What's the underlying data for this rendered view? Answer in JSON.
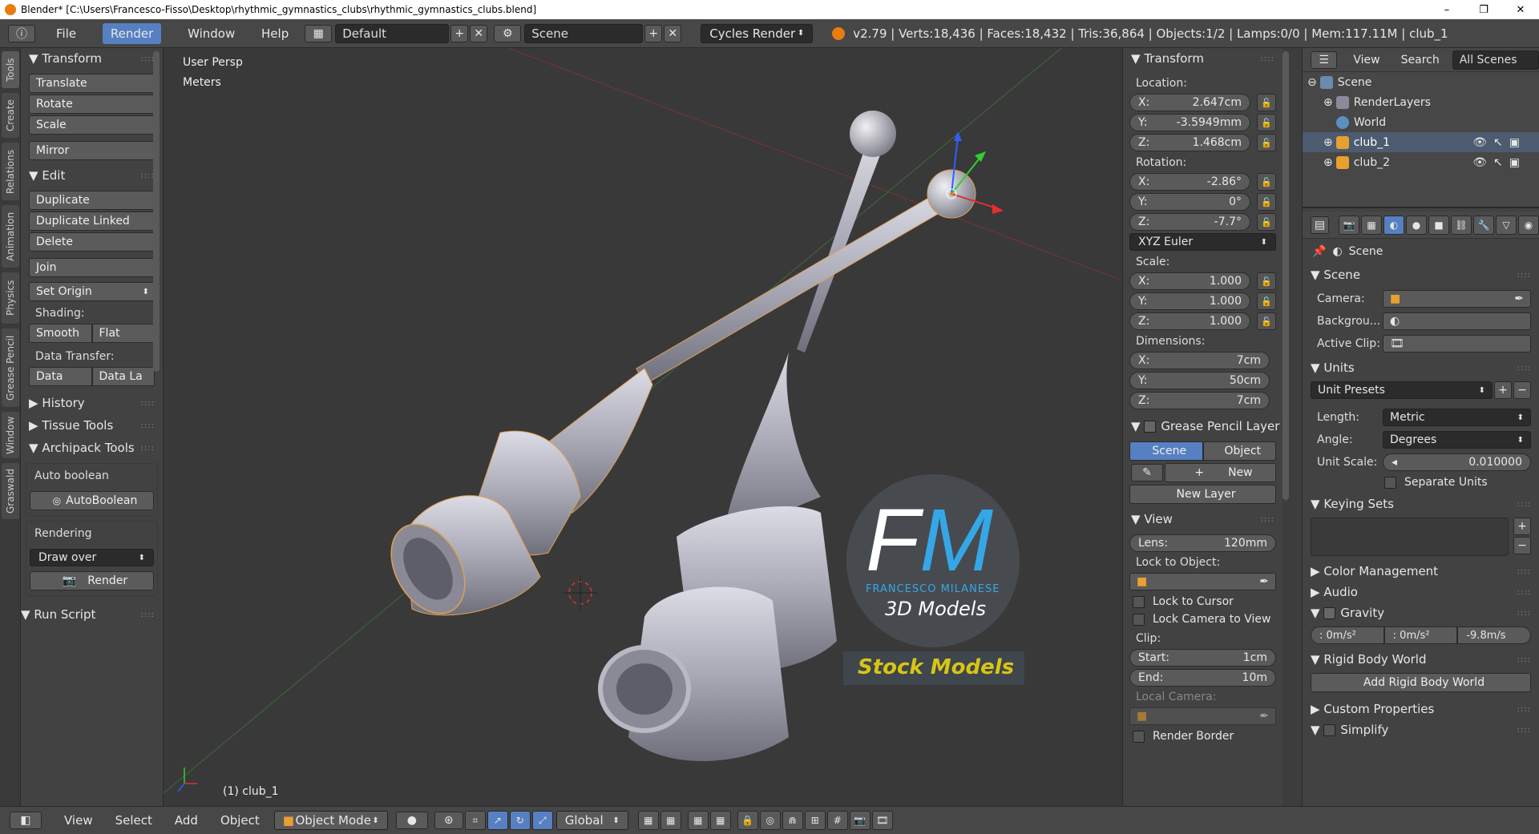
{
  "titlebar": {
    "title": "Blender* [C:\\Users\\Francesco-Fisso\\Desktop\\rhythmic_gymnastics_clubs\\rhythmic_gymnastics_clubs.blend]",
    "minimize": "–",
    "maximize": "❐",
    "close": "✕"
  },
  "info": {
    "menu": [
      "File",
      "Render",
      "Window",
      "Help"
    ],
    "layout": "Default",
    "scene": "Scene",
    "engine": "Cycles Render",
    "stats": "v2.79 | Verts:18,436 | Faces:18,432 | Tris:36,864 | Objects:1/2 | Lamps:0/0 | Mem:117.11M | club_1"
  },
  "lefttabs": [
    "Tools",
    "Create",
    "Relations",
    "Animation",
    "Physics",
    "Grease Pencil",
    "Window",
    "Graswald"
  ],
  "tools": {
    "transform_title": "Transform",
    "translate": "Translate",
    "rotate": "Rotate",
    "scale": "Scale",
    "mirror": "Mirror",
    "edit_title": "Edit",
    "duplicate": "Duplicate",
    "duplicate_linked": "Duplicate Linked",
    "delete": "Delete",
    "join": "Join",
    "set_origin": "Set Origin",
    "shading": "Shading:",
    "smooth": "Smooth",
    "flat": "Flat",
    "data_transfer": "Data Transfer:",
    "data": "Data",
    "data_la": "Data La",
    "history": "History",
    "tissue": "Tissue Tools",
    "archipack": "Archipack Tools",
    "auto_boolean": "Auto boolean",
    "autoboolean_btn": "AutoBoolean",
    "rendering": "Rendering",
    "draw_over": "Draw over",
    "render": "Render",
    "run_script": "Run Script"
  },
  "viewport": {
    "persp": "User Persp",
    "units": "Meters",
    "object": "(1) club_1",
    "watermark_fm": "FM",
    "watermark_name": "FRANCESCO MILANESE",
    "watermark_sub": "3D Models",
    "watermark_stock": "Stock Models"
  },
  "npanel": {
    "transform": "Transform",
    "location": "Location:",
    "loc": [
      {
        "a": "X:",
        "v": "2.647cm"
      },
      {
        "a": "Y:",
        "v": "-3.5949mm"
      },
      {
        "a": "Z:",
        "v": "1.468cm"
      }
    ],
    "rotation": "Rotation:",
    "rot": [
      {
        "a": "X:",
        "v": "-2.86°"
      },
      {
        "a": "Y:",
        "v": "0°"
      },
      {
        "a": "Z:",
        "v": "-7.7°"
      }
    ],
    "euler": "XYZ Euler",
    "scale": "Scale:",
    "sca": [
      {
        "a": "X:",
        "v": "1.000"
      },
      {
        "a": "Y:",
        "v": "1.000"
      },
      {
        "a": "Z:",
        "v": "1.000"
      }
    ],
    "dimensions": "Dimensions:",
    "dim": [
      {
        "a": "X:",
        "v": "7cm"
      },
      {
        "a": "Y:",
        "v": "50cm"
      },
      {
        "a": "Z:",
        "v": "7cm"
      }
    ],
    "gp": "Grease Pencil Layer",
    "gp_scene": "Scene",
    "gp_object": "Object",
    "gp_new": "New",
    "gp_newlayer": "New Layer",
    "view": "View",
    "lens_lbl": "Lens:",
    "lens_val": "120mm",
    "lock_obj": "Lock to Object:",
    "lock_cursor": "Lock to Cursor",
    "lock_cam": "Lock Camera to View",
    "clip": "Clip:",
    "start_lbl": "Start:",
    "start_val": "1cm",
    "end_lbl": "End:",
    "end_val": "10m",
    "local_cam": "Local Camera:",
    "render_border": "Render Border"
  },
  "outliner": {
    "view": "View",
    "search": "Search",
    "all_scenes": "All Scenes",
    "scene": "Scene",
    "renderlayers": "RenderLayers",
    "world": "World",
    "club1": "club_1",
    "club2": "club_2"
  },
  "props": {
    "crumb": "Scene",
    "scene_title": "Scene",
    "camera": "Camera:",
    "background": "Backgrou...",
    "active_clip": "Active Clip:",
    "units_title": "Units",
    "unit_presets": "Unit Presets",
    "length": "Length:",
    "length_val": "Metric",
    "angle": "Angle:",
    "angle_val": "Degrees",
    "unit_scale": "Unit Scale:",
    "unit_scale_val": "0.010000",
    "separate": "Separate Units",
    "keying": "Keying Sets",
    "color_mgmt": "Color Management",
    "audio": "Audio",
    "gravity": "Gravity",
    "grav": [
      ": 0m/s²",
      ": 0m/s²",
      "-9.8m/s"
    ],
    "rigid": "Rigid Body World",
    "add_rigid": "Add Rigid Body World",
    "custom": "Custom Properties",
    "simplify": "Simplify"
  },
  "bottom": {
    "menu": [
      "View",
      "Select",
      "Add",
      "Object"
    ],
    "mode": "Object Mode",
    "orientation": "Global"
  },
  "colors": {
    "accent": "#5680c2",
    "stock": "#d8c514",
    "watermark_blue": "#35a7e8"
  }
}
